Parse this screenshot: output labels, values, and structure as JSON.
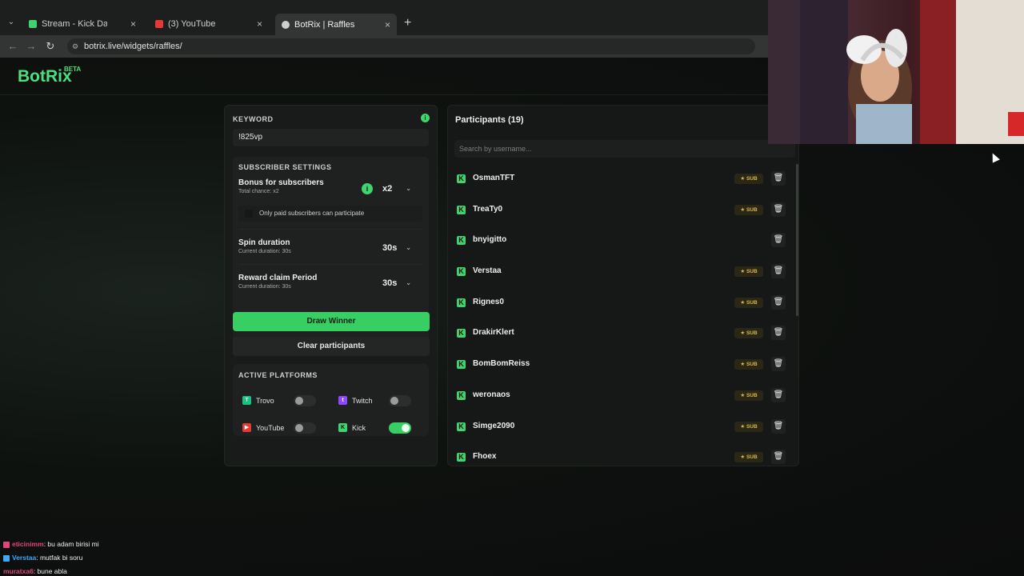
{
  "browser": {
    "tabs": [
      {
        "label": "Stream - Kick Dashboard",
        "favicon_color": "#3fd46c",
        "active": false
      },
      {
        "label": "(3) YouTube",
        "favicon_color": "#e53935",
        "active": false
      },
      {
        "label": "BotRix | Raffles",
        "favicon_color": "#cfcfcf",
        "active": true
      }
    ],
    "new_tab_symbol": "+",
    "url": "botrix.live/widgets/raffles/"
  },
  "app": {
    "logo": "BotRix",
    "logo_badge": "BETA",
    "accent": "#3fd46c"
  },
  "settings": {
    "keyword_label": "KEYWORD",
    "keyword_value": "!825vp",
    "subscriber_section": "SUBSCRIBER SETTINGS",
    "bonus": {
      "title": "Bonus for subscribers",
      "subtitle": "Total chance: x2",
      "value": "x2"
    },
    "paid_only": {
      "label": "Only paid subscribers can participate",
      "checked": false
    },
    "spin": {
      "title": "Spin duration",
      "subtitle": "Current duration: 30s",
      "value": "30s"
    },
    "reward": {
      "title": "Reward claim Period",
      "subtitle": "Current duration: 30s",
      "value": "30s"
    },
    "draw_button": "Draw Winner",
    "clear_button": "Clear participants",
    "platforms_title": "ACTIVE PLATFORMS",
    "platforms": [
      {
        "name": "Trovo",
        "enabled": false,
        "color": "#19c37d"
      },
      {
        "name": "Twitch",
        "enabled": false,
        "color": "#9146ff"
      },
      {
        "name": "YouTube",
        "enabled": false,
        "color": "#e53935"
      },
      {
        "name": "Kick",
        "enabled": true,
        "color": "#3fd46c"
      }
    ]
  },
  "participants": {
    "title": "Participants (19)",
    "search_placeholder": "Search by username...",
    "sub_label": "SUB",
    "list": [
      {
        "name": "OsmanTFT",
        "sub": true
      },
      {
        "name": "TreaTy0",
        "sub": true
      },
      {
        "name": "bnyigitto",
        "sub": false
      },
      {
        "name": "Verstaa",
        "sub": true
      },
      {
        "name": "Rignes0",
        "sub": true
      },
      {
        "name": "DrakirKlert",
        "sub": true
      },
      {
        "name": "BomBomReiss",
        "sub": true
      },
      {
        "name": "weronaos",
        "sub": true
      },
      {
        "name": "Simge2090",
        "sub": true
      },
      {
        "name": "Fhoex",
        "sub": true
      }
    ]
  },
  "chat": [
    {
      "user": "eticinimm",
      "message": ": bu adam birisi mi",
      "color": "#e0457b"
    },
    {
      "user": "Verstaa",
      "message": ": mutfak bi soru",
      "color": "#3fa9f5"
    },
    {
      "user": "muratxa6",
      "message": ": bune abla",
      "color": "#e0457b"
    }
  ]
}
